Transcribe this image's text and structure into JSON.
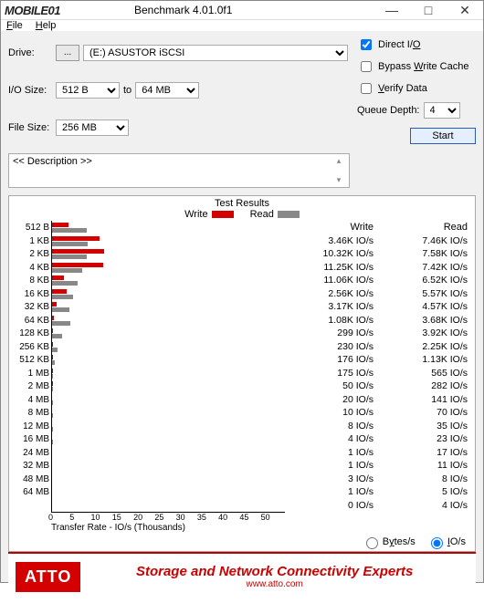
{
  "window": {
    "logo_text": "MOBILE01",
    "title": "Benchmark 4.01.0f1"
  },
  "menu": {
    "file_html": "<u>F</u>ile",
    "help_html": "<u>H</u>elp"
  },
  "labels": {
    "drive": "Drive:",
    "iosize": "I/O Size:",
    "filesize": "File Size:",
    "to": "to",
    "dots": "...",
    "direct_io": "Direct I/O",
    "bypass_write_cache": "Bypass Write Cache",
    "verify_data": "Verify Data",
    "queue_depth": "Queue Depth:",
    "start": "Start",
    "description": "<< Description >>",
    "test_results": "Test Results",
    "write": "Write",
    "read": "Read",
    "xaxis": "Transfer Rate - IO/s (Thousands)",
    "bytes_per_s": "Bytes/s",
    "io_per_s": "IO/s"
  },
  "settings": {
    "drive": "(E:) ASUSTOR iSCSI",
    "iosize_from": "512 B",
    "iosize_to": "64 MB",
    "filesize": "256 MB",
    "direct_io": true,
    "bypass_write_cache": false,
    "verify_data": false,
    "queue_depth": "4",
    "unit": "IO/s"
  },
  "chart_data": {
    "type": "bar",
    "title": "Test Results",
    "xlabel": "Transfer Rate - IO/s (Thousands)",
    "xlim": [
      0,
      50
    ],
    "xticks": [
      0,
      5,
      10,
      15,
      20,
      25,
      30,
      35,
      40,
      45,
      50
    ],
    "categories": [
      "512 B",
      "1 KB",
      "2 KB",
      "4 KB",
      "8 KB",
      "16 KB",
      "32 KB",
      "64 KB",
      "128 KB",
      "256 KB",
      "512 KB",
      "1 MB",
      "2 MB",
      "4 MB",
      "8 MB",
      "12 MB",
      "16 MB",
      "24 MB",
      "32 MB",
      "48 MB",
      "64 MB"
    ],
    "series": [
      {
        "name": "Write",
        "color": "#d40000",
        "values_kios": [
          3.46,
          10.32,
          11.25,
          11.06,
          2.56,
          3.17,
          1.08,
          0.299,
          0.23,
          0.176,
          0.175,
          0.05,
          0.02,
          0.01,
          0.008,
          0.004,
          0.001,
          0.001,
          0.003,
          0.001,
          0.0
        ],
        "display": [
          "3.46K IO/s",
          "10.32K IO/s",
          "11.25K IO/s",
          "11.06K IO/s",
          "2.56K IO/s",
          "3.17K IO/s",
          "1.08K IO/s",
          "299 IO/s",
          "230 IO/s",
          "176 IO/s",
          "175 IO/s",
          "50 IO/s",
          "20 IO/s",
          "10 IO/s",
          "8 IO/s",
          "4 IO/s",
          "1 IO/s",
          "1 IO/s",
          "3 IO/s",
          "1 IO/s",
          "0 IO/s"
        ]
      },
      {
        "name": "Read",
        "color": "#888888",
        "values_kios": [
          7.46,
          7.58,
          7.42,
          6.52,
          5.57,
          4.57,
          3.68,
          3.92,
          2.25,
          1.13,
          0.565,
          0.282,
          0.141,
          0.07,
          0.035,
          0.023,
          0.017,
          0.011,
          0.008,
          0.005,
          0.004
        ],
        "display": [
          "7.46K IO/s",
          "7.58K IO/s",
          "7.42K IO/s",
          "6.52K IO/s",
          "5.57K IO/s",
          "4.57K IO/s",
          "3.68K IO/s",
          "3.92K IO/s",
          "2.25K IO/s",
          "1.13K IO/s",
          "565 IO/s",
          "282 IO/s",
          "141 IO/s",
          "70 IO/s",
          "35 IO/s",
          "23 IO/s",
          "17 IO/s",
          "11 IO/s",
          "8 IO/s",
          "5 IO/s",
          "4 IO/s"
        ]
      }
    ]
  },
  "footer": {
    "logo": "ATTO",
    "line1": "Storage and Network Connectivity Experts",
    "line2": "www.atto.com"
  }
}
